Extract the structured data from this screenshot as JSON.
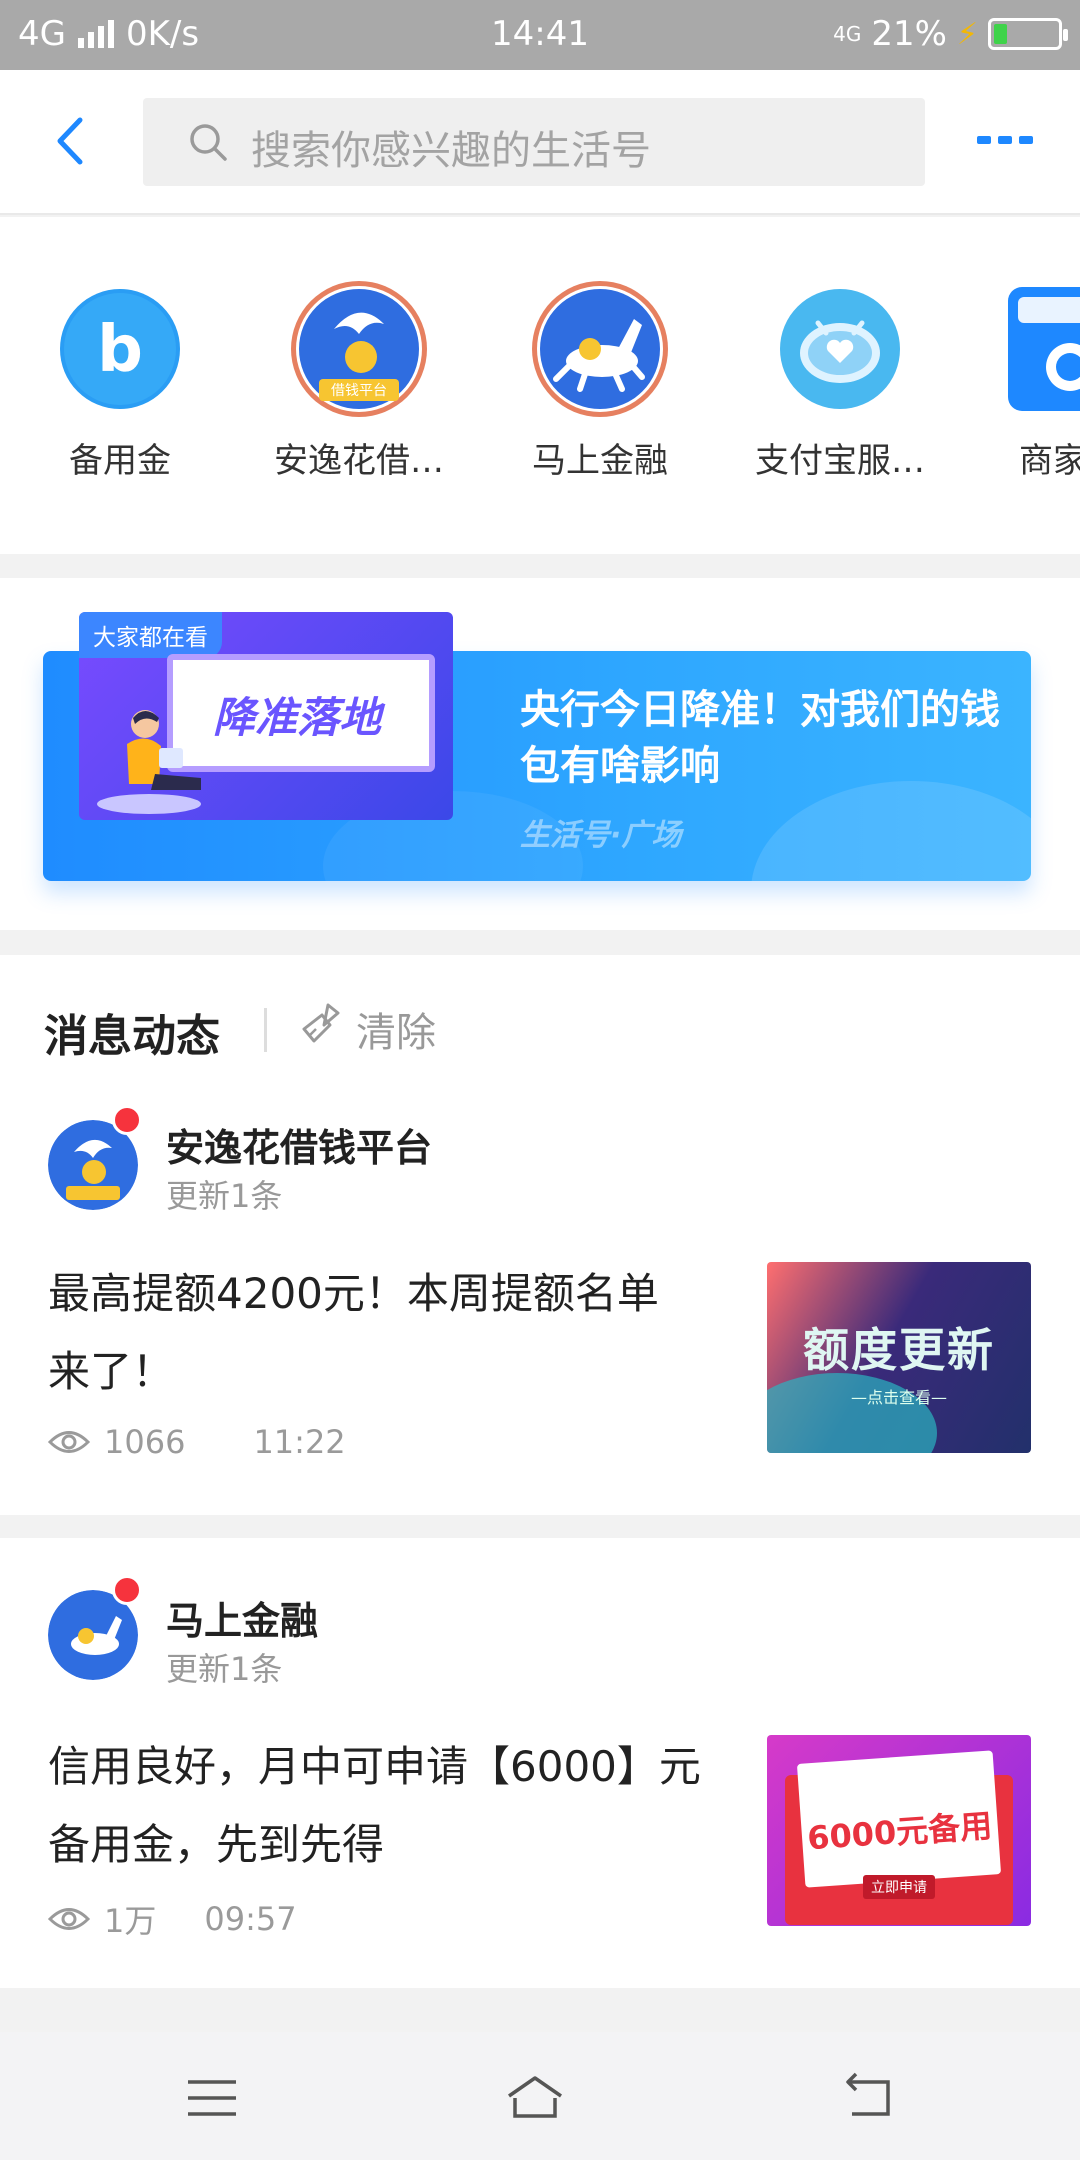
{
  "status_bar": {
    "network": "4G",
    "speed": "0K/s",
    "time": "14:41",
    "network_right": "4G",
    "battery_percent": "21%",
    "battery_level": 0.21
  },
  "header": {
    "search_placeholder": "搜索你感兴趣的生活号",
    "back_icon": "back-arrow-icon",
    "more_icon": "more-dots-icon"
  },
  "accounts": [
    {
      "label": "备用金",
      "icon": "beiyongjin-b-icon"
    },
    {
      "label": "安逸花借…",
      "icon": "anyihua-logo-icon"
    },
    {
      "label": "马上金融",
      "icon": "mashang-horse-icon"
    },
    {
      "label": "支付宝服…",
      "icon": "alipay-service-robot-icon"
    },
    {
      "label": "商家转",
      "icon": "merchant-store-icon"
    }
  ],
  "banner": {
    "tag": "大家都在看",
    "thumb_text": "降准落地",
    "title": "央行今日降准！对我们的钱包有啥影响",
    "source": "生活号·广场"
  },
  "news": {
    "section_title": "消息动态",
    "clear_label": "清除",
    "items": [
      {
        "name": "安逸花借钱平台",
        "sub": "更新1条",
        "text": "最高提额4200元！本周提额名单来了！",
        "views": "1066",
        "time": "11:22",
        "image_text": "额度更新",
        "image_sub": "—点击查看—"
      },
      {
        "name": "马上金融",
        "sub": "更新1条",
        "text": "信用良好，月中可申请【6000】元备用金，先到先得",
        "views": "1万",
        "time": "09:57",
        "image_text": "6000元备用",
        "image_sub": "立即申请"
      }
    ]
  },
  "colors": {
    "accent": "#1e88ff",
    "reddot": "#f6333d"
  }
}
